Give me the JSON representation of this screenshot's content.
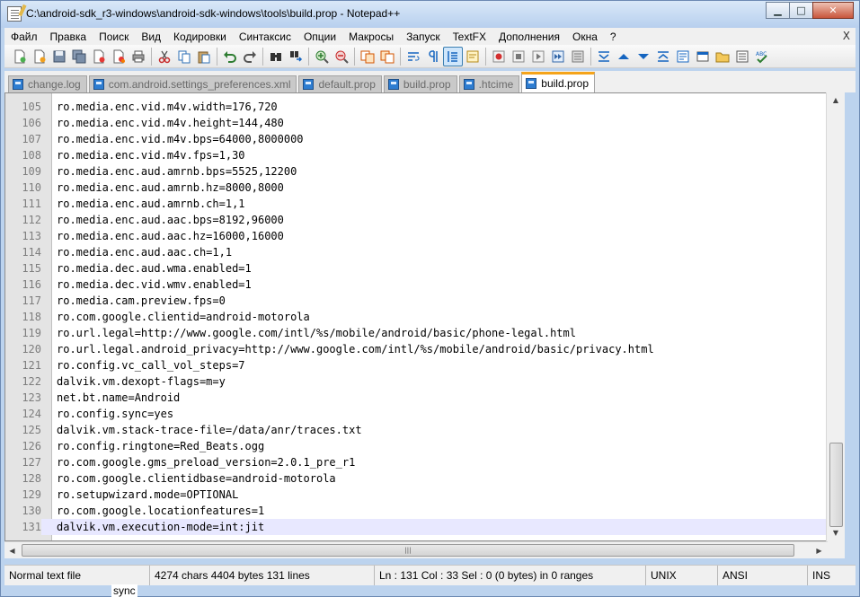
{
  "window": {
    "title": "C:\\android-sdk_r3-windows\\android-sdk-windows\\tools\\build.prop - Notepad++",
    "minimize_glyph": "▁",
    "maximize_glyph": "□",
    "close_glyph": "✕"
  },
  "menu": {
    "items": [
      "Файл",
      "Правка",
      "Поиск",
      "Вид",
      "Кодировки",
      "Синтаксис",
      "Опции",
      "Макросы",
      "Запуск",
      "TextFX",
      "Дополнения",
      "Окна",
      "?"
    ],
    "close_label": "X"
  },
  "toolbar": {
    "groups": [
      [
        "new-file-icon",
        "open-file-icon",
        "save-icon",
        "save-all-icon",
        "close-icon",
        "close-all-icon",
        "print-icon"
      ],
      [
        "cut-icon",
        "copy-icon",
        "paste-icon"
      ],
      [
        "undo-icon",
        "redo-icon"
      ],
      [
        "find-icon",
        "replace-icon"
      ],
      [
        "zoom-in-icon",
        "zoom-out-icon"
      ],
      [
        "sync-vertical-icon",
        "sync-horizontal-icon"
      ],
      [
        "word-wrap-icon",
        "show-all-chars-icon",
        "indent-guide-icon",
        "user-lang-icon"
      ],
      [
        "record-macro-icon",
        "stop-macro-icon",
        "play-macro-icon",
        "run-macro-multiple-icon",
        "save-macro-icon"
      ],
      [
        "collapse-icon",
        "up-arrow-icon",
        "down-arrow-icon",
        "expand-icon",
        "doc-map-icon",
        "function-list-icon",
        "folder-icon",
        "monitoring-icon",
        "spellcheck-icon"
      ]
    ],
    "active": "indent-guide-icon"
  },
  "tabs": [
    {
      "label": "change.log",
      "active": false
    },
    {
      "label": "com.android.settings_preferences.xml",
      "active": false
    },
    {
      "label": "default.prop",
      "active": false
    },
    {
      "label": "build.prop",
      "active": false
    },
    {
      "label": ".htcime",
      "active": false
    },
    {
      "label": "build.prop",
      "active": true
    }
  ],
  "editor": {
    "current_line": 131,
    "lines": [
      {
        "n": "105",
        "text": "ro.media.enc.vid.m4v.width=176,720"
      },
      {
        "n": "106",
        "text": "ro.media.enc.vid.m4v.height=144,480"
      },
      {
        "n": "107",
        "text": "ro.media.enc.vid.m4v.bps=64000,8000000"
      },
      {
        "n": "108",
        "text": "ro.media.enc.vid.m4v.fps=1,30"
      },
      {
        "n": "109",
        "text": "ro.media.enc.aud.amrnb.bps=5525,12200"
      },
      {
        "n": "110",
        "text": "ro.media.enc.aud.amrnb.hz=8000,8000"
      },
      {
        "n": "111",
        "text": "ro.media.enc.aud.amrnb.ch=1,1"
      },
      {
        "n": "112",
        "text": "ro.media.enc.aud.aac.bps=8192,96000"
      },
      {
        "n": "113",
        "text": "ro.media.enc.aud.aac.hz=16000,16000"
      },
      {
        "n": "114",
        "text": "ro.media.enc.aud.aac.ch=1,1"
      },
      {
        "n": "115",
        "text": "ro.media.dec.aud.wma.enabled=1"
      },
      {
        "n": "116",
        "text": "ro.media.dec.vid.wmv.enabled=1"
      },
      {
        "n": "117",
        "text": "ro.media.cam.preview.fps=0"
      },
      {
        "n": "118",
        "text": "ro.com.google.clientid=android-motorola"
      },
      {
        "n": "119",
        "text": "ro.url.legal=http://www.google.com/intl/%s/mobile/android/basic/phone-legal.html"
      },
      {
        "n": "120",
        "text": "ro.url.legal.android_privacy=http://www.google.com/intl/%s/mobile/android/basic/privacy.html"
      },
      {
        "n": "121",
        "text": "ro.config.vc_call_vol_steps=7"
      },
      {
        "n": "122",
        "text": "dalvik.vm.dexopt-flags=m=y"
      },
      {
        "n": "123",
        "text": "net.bt.name=Android"
      },
      {
        "n": "124",
        "text": "ro.config.sync=yes"
      },
      {
        "n": "125",
        "text": "dalvik.vm.stack-trace-file=/data/anr/traces.txt"
      },
      {
        "n": "126",
        "text": "ro.config.ringtone=Red_Beats.ogg"
      },
      {
        "n": "127",
        "text": "ro.com.google.gms_preload_version=2.0.1_pre_r1"
      },
      {
        "n": "128",
        "text": "ro.com.google.clientidbase=android-motorola"
      },
      {
        "n": "129",
        "text": "ro.setupwizard.mode=OPTIONAL"
      },
      {
        "n": "130",
        "text": "ro.com.google.locationfeatures=1"
      },
      {
        "n": "131",
        "text": "dalvik.vm.execution-mode=int:jit"
      }
    ]
  },
  "scroll": {
    "hthumb_glyph": "|||",
    "up_glyph": "▲",
    "down_glyph": "▼",
    "left_glyph": "◀",
    "right_glyph": "▶"
  },
  "status": {
    "file_type": "Normal text file",
    "length": "4274 chars   4404 bytes   131 lines",
    "position": "Ln : 131    Col : 33    Sel : 0 (0 bytes) in 0 ranges",
    "eol": "UNIX",
    "encoding": "ANSI",
    "mode": "INS"
  },
  "behind_window_text": "sync",
  "colors": {
    "tab_active_accent": "#f5a41a",
    "current_line_bg": "#e8e8ff",
    "gutter_bg": "#e4e4e4",
    "line_number_fg": "#7d7d7d"
  }
}
